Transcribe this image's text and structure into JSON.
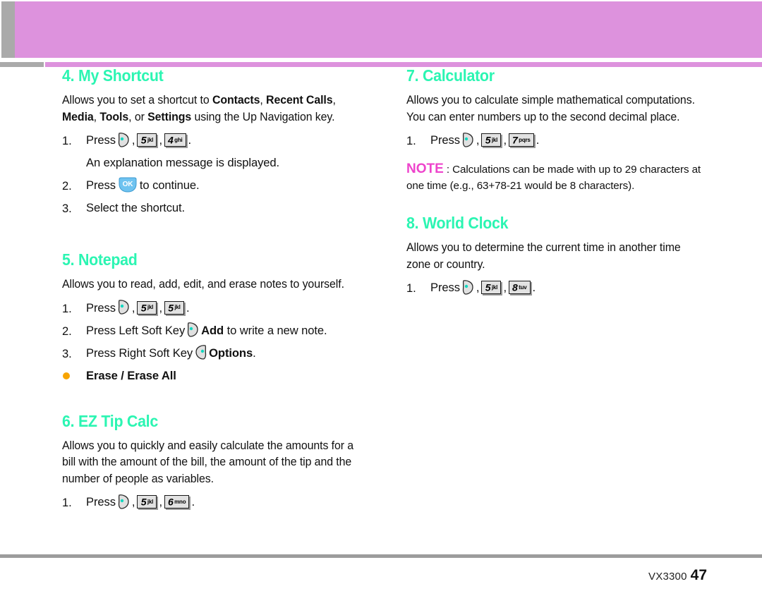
{
  "page": {
    "header_band_color": "#dd92dd",
    "header_tab_color": "#aaaaaa",
    "heading_color": "#2BF5B2",
    "note_color": "#EE44CC",
    "bullet_color": "#F7A400",
    "footer_rule_color": "#9c9c9c"
  },
  "footer": {
    "model": "VX3300",
    "page_number": "47"
  },
  "sections": {
    "my_shortcut": {
      "heading": "4. My Shortcut",
      "intro_a": "Allows you to set a shortcut to ",
      "intro_b1": "Contacts",
      "intro_c": ", ",
      "intro_b2": "Recent Calls",
      "intro_d": ",",
      "intro_b3": "Media",
      "intro_e": ", ",
      "intro_b4": "Tools",
      "intro_f": ", or ",
      "intro_b5": "Settings",
      "intro_g": " using the Up Navigation key.",
      "step1_num": "1.",
      "step1_press": "Press",
      "step1_comma1": ",",
      "step1_comma2": ",",
      "step1_period": ".",
      "step1_key1_digit": "5",
      "step1_key1_letters": "jkl",
      "step1_key2_digit": "4",
      "step1_key2_letters": "ghi",
      "step1_note": "An explanation message is displayed.",
      "step2_num": "2.",
      "step2_press": "Press",
      "step2_ok": "OK",
      "step2_tail": "to continue.",
      "step3_num": "3.",
      "step3_text": "Select the shortcut."
    },
    "notepad": {
      "heading": "5. Notepad",
      "intro": "Allows you to read, add, edit, and erase notes to yourself.",
      "step1_num": "1.",
      "step1_press": "Press",
      "step1_comma1": ",",
      "step1_comma2": ",",
      "step1_period": ".",
      "step1_key1_digit": "5",
      "step1_key1_letters": "jkl",
      "step1_key2_digit": "5",
      "step1_key2_letters": "jkl",
      "step2_num": "2.",
      "step2_lead": "Press Left Soft Key",
      "step2_bold": "Add",
      "step2_tail": "to write a new note.",
      "step3_num": "3.",
      "step3_lead": "Press Right Soft Key",
      "step3_bold": "Options",
      "step3_tail": ".",
      "bullet": "Erase / Erase All"
    },
    "ez_tip_calc": {
      "heading": "6. EZ Tip Calc",
      "intro": "Allows you to quickly and easily calculate the amounts for a bill with the amount of the bill, the amount of the tip and the number of people as variables.",
      "step1_num": "1.",
      "step1_press": "Press",
      "step1_comma1": ",",
      "step1_comma2": ",",
      "step1_period": ".",
      "step1_key1_digit": "5",
      "step1_key1_letters": "jkl",
      "step1_key2_digit": "6",
      "step1_key2_letters": "mno"
    },
    "calculator": {
      "heading": "7. Calculator",
      "intro": "Allows you to calculate simple mathematical computations. You can enter numbers up to the second decimal place.",
      "step1_num": "1.",
      "step1_press": "Press",
      "step1_comma1": ",",
      "step1_comma2": ",",
      "step1_period": ".",
      "step1_key1_digit": "5",
      "step1_key1_letters": "jkl",
      "step1_key2_digit": "7",
      "step1_key2_letters": "pqrs",
      "note_label": "NOTE",
      "note_text": " : Calculations can be made with up to 29 characters at one time (e.g., 63+78-21 would be 8 characters)."
    },
    "world_clock": {
      "heading": "8. World Clock",
      "intro": "Allows you to determine the current time in another time zone or country.",
      "step1_num": "1.",
      "step1_press": "Press",
      "step1_comma1": ",",
      "step1_comma2": ",",
      "step1_period": ".",
      "step1_key1_digit": "5",
      "step1_key1_letters": "jkl",
      "step1_key2_digit": "8",
      "step1_key2_letters": "tuv"
    }
  }
}
